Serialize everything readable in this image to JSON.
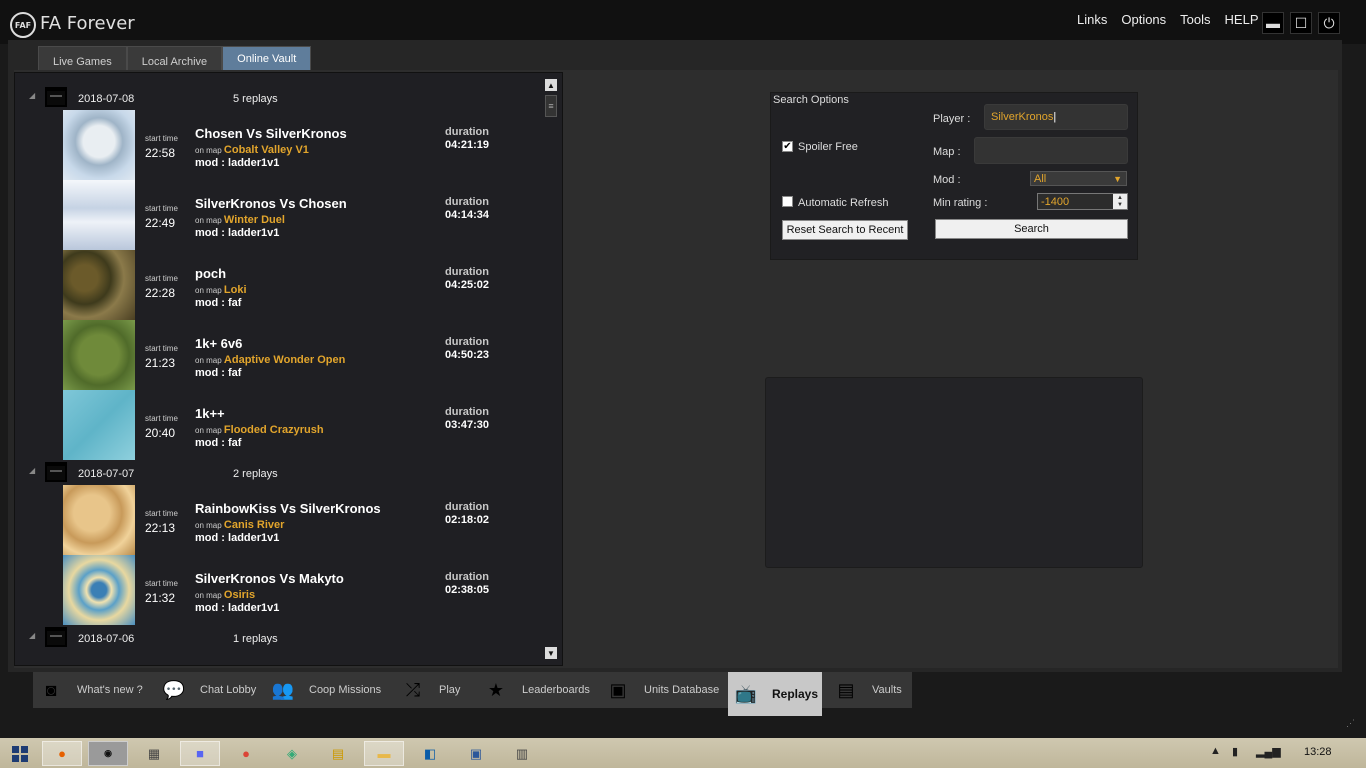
{
  "app": {
    "title": "FA Forever",
    "logo_text": "FAF"
  },
  "top_menu": [
    "Links",
    "Options",
    "Tools",
    "HELP"
  ],
  "window_controls": {
    "minimize": "▬",
    "maximize": "☐",
    "power": "⏻"
  },
  "tabs": [
    {
      "label": "Live Games",
      "active": false
    },
    {
      "label": "Local Archive",
      "active": false
    },
    {
      "label": "Online Vault",
      "active": true
    }
  ],
  "replay_list": {
    "start_time_label": "start time",
    "on_map_label": "on map",
    "mod_label": "mod :",
    "duration_label": "duration",
    "days": [
      {
        "date": "2018-07-08",
        "count": "5 replays",
        "games": [
          {
            "title": "Chosen Vs SilverKronos",
            "start": "22:58",
            "map": "Cobalt Valley V1",
            "mod": "ladder1v1",
            "duration": "04:21:19",
            "thumb": "snow-icy"
          },
          {
            "title": "SilverKronos Vs Chosen",
            "start": "22:49",
            "map": "Winter Duel",
            "mod": "ladder1v1",
            "duration": "04:14:34",
            "thumb": "snow"
          },
          {
            "title": "poch",
            "start": "22:28",
            "map": "Loki",
            "mod": "faf",
            "duration": "04:25:02",
            "thumb": "canyon"
          },
          {
            "title": "1k+ 6v6",
            "start": "21:23",
            "map": "Adaptive Wonder Open",
            "mod": "faf",
            "duration": "04:50:23",
            "thumb": "grass"
          },
          {
            "title": "1k++",
            "start": "20:40",
            "map": "Flooded Crazyrush",
            "mod": "faf",
            "duration": "03:47:30",
            "thumb": "water"
          }
        ]
      },
      {
        "date": "2018-07-07",
        "count": "2 replays",
        "games": [
          {
            "title": "RainbowKiss Vs SilverKronos",
            "start": "22:13",
            "map": "Canis River",
            "mod": "ladder1v1",
            "duration": "02:18:02",
            "thumb": "desert"
          },
          {
            "title": "SilverKronos Vs Makyto",
            "start": "21:32",
            "map": "Osiris",
            "mod": "ladder1v1",
            "duration": "02:38:05",
            "thumb": "island"
          }
        ]
      },
      {
        "date": "2018-07-06",
        "count": "1 replays",
        "games": []
      }
    ]
  },
  "search": {
    "title": "Search Options",
    "player_label": "Player :",
    "player_value": "SilverKronos",
    "spoiler_label": "Spoiler Free",
    "spoiler_checked": "✔",
    "map_label": "Map :",
    "map_value": "",
    "mod_label": "Mod :",
    "mod_value": "All",
    "auto_refresh_label": "Automatic Refresh",
    "min_rating_label": "Min rating :",
    "min_rating_value": "-1400",
    "reset_button": "Reset Search to Recent",
    "search_button": "Search"
  },
  "bottom_nav": [
    {
      "label": "What's new ?",
      "icon": "rss-icon",
      "glyph": "◙"
    },
    {
      "label": "Chat Lobby",
      "icon": "chat-icon",
      "glyph": "💬"
    },
    {
      "label": "Coop Missions",
      "icon": "users-icon",
      "glyph": "👥"
    },
    {
      "label": "Play",
      "icon": "shuffle-icon",
      "glyph": "⤮"
    },
    {
      "label": "Leaderboards",
      "icon": "medal-icon",
      "glyph": "★"
    },
    {
      "label": "Units Database",
      "icon": "twitch-icon",
      "glyph": "▣"
    },
    {
      "label": "Replays",
      "icon": "tv-icon",
      "glyph": "📺",
      "active": true
    },
    {
      "label": "Vaults",
      "icon": "file-icon",
      "glyph": "▤"
    }
  ],
  "taskbar": {
    "clock": "13:28"
  },
  "colors": {
    "accent_orange": "#e2a52c",
    "active_tab": "#5f7d9b"
  }
}
